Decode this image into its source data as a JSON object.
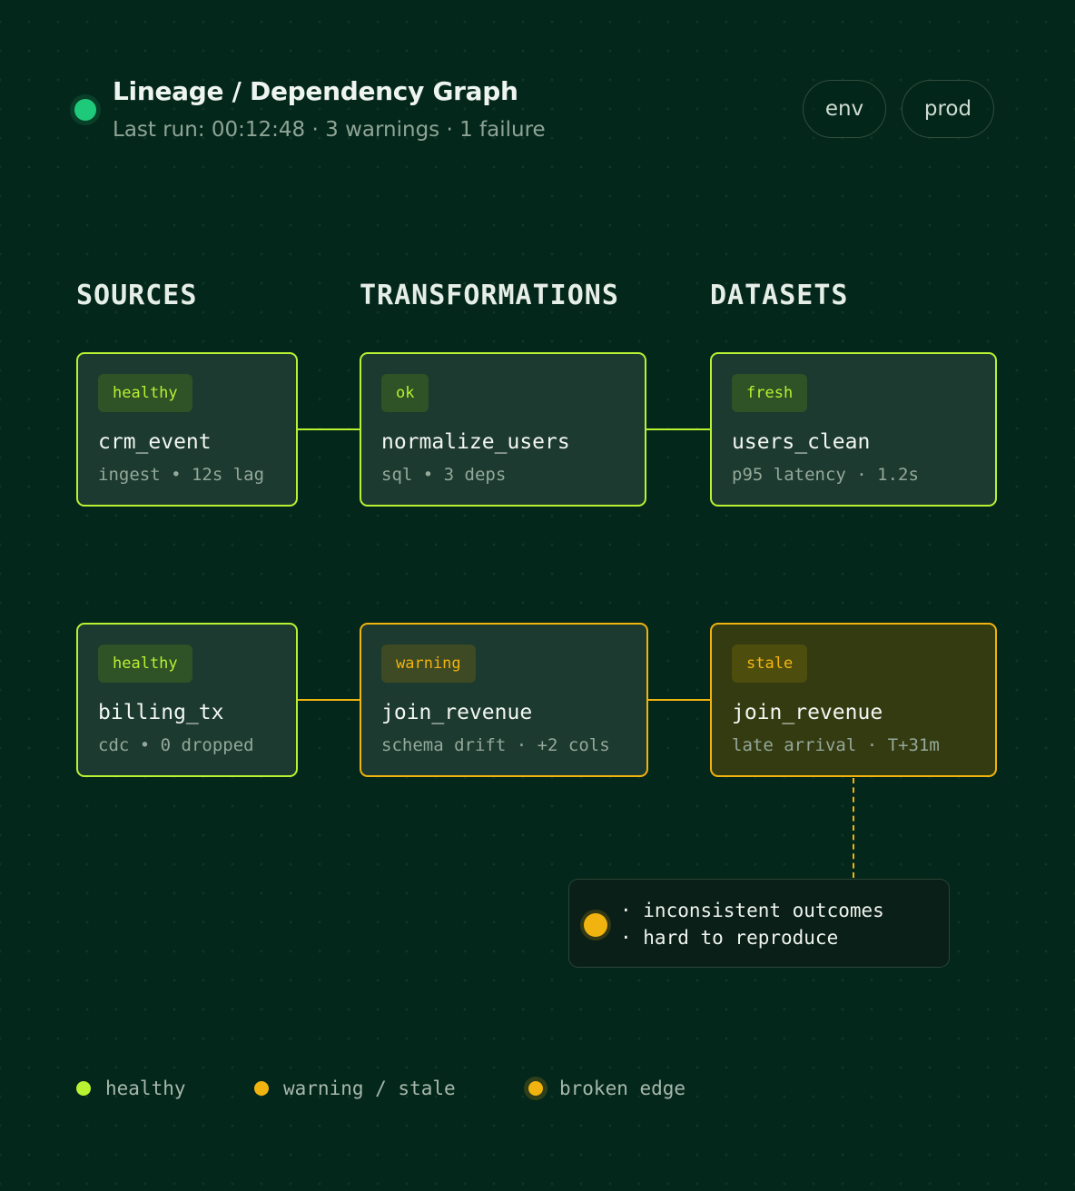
{
  "header": {
    "title": "Lineage / Dependency Graph",
    "subtitle": "Last run: 00:12:48 · 3 warnings · 1 failure",
    "status_color": "#1fc97a",
    "pills": [
      "env",
      "prod"
    ]
  },
  "columns": [
    "SOURCES",
    "TRANSFORMATIONS",
    "DATASETS"
  ],
  "nodes": {
    "crm_event": {
      "badge": "healthy",
      "name": "crm_event",
      "meta": "ingest • 12s lag",
      "status": "healthy"
    },
    "normalize_users": {
      "badge": "ok",
      "name": "normalize_users",
      "meta": "sql • 3 deps",
      "status": "healthy"
    },
    "users_clean": {
      "badge": "fresh",
      "name": "users_clean",
      "meta": "p95 latency · 1.2s",
      "status": "healthy"
    },
    "billing_tx": {
      "badge": "healthy",
      "name": "billing_tx",
      "meta": "cdc • 0 dropped",
      "status": "healthy"
    },
    "join_revenue_transform": {
      "badge": "warning",
      "name": "join_revenue",
      "meta": "schema drift · +2 cols",
      "status": "warning"
    },
    "join_revenue_dataset": {
      "badge": "stale",
      "name": "join_revenue",
      "meta": "late arrival · T+31m",
      "status": "stale"
    }
  },
  "callout": {
    "lines": [
      "· inconsistent outcomes",
      "· hard to reproduce"
    ],
    "dot_color": "#f1b30f"
  },
  "legend": [
    {
      "label": "healthy",
      "color": "#b8f232"
    },
    {
      "label": "warning / stale",
      "color": "#f1b30f"
    },
    {
      "label": "broken edge",
      "color": "#f1b30f"
    }
  ],
  "colors": {
    "background": "#04271b",
    "healthy": "#b8f232",
    "warning": "#f1b30f",
    "node_fill": "#1c3a2f",
    "stale_fill": "#343b10"
  }
}
